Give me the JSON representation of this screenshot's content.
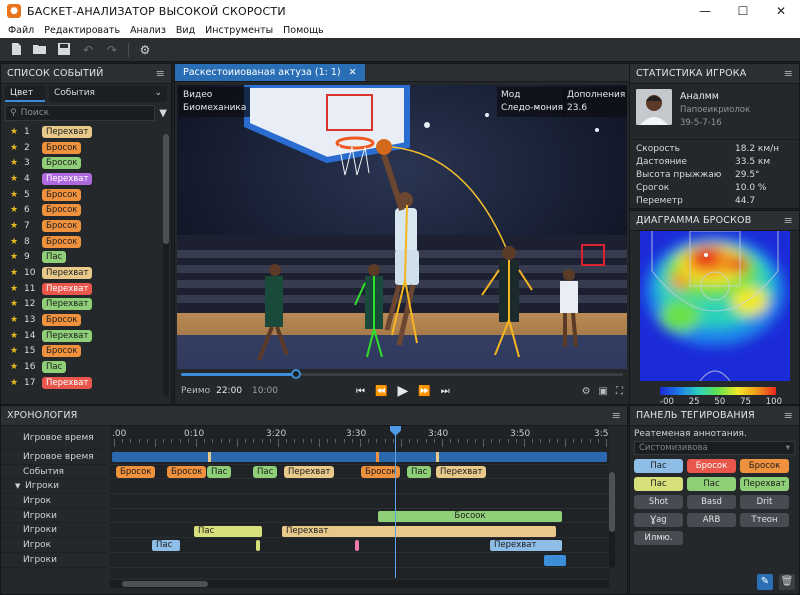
{
  "window": {
    "title": "БАСКЕТ-АНАЛИЗАТОР ВЫСОКОЙ СКОРОСТИ",
    "minimize": "—",
    "maximize": "☐",
    "close": "✕"
  },
  "menu": [
    "Файл",
    "Редактировать",
    "Анализ",
    "Вид",
    "Инструменты",
    "Помощь"
  ],
  "events_panel": {
    "title": "СПИСОК СОБЫТИЙ",
    "filter_color": "Цвет",
    "filter_events": "События",
    "search_placeholder": "Поиск",
    "items": [
      {
        "n": "1",
        "label": "Перехват",
        "color": "tan"
      },
      {
        "n": "2",
        "label": "Бросок",
        "color": "orange"
      },
      {
        "n": "3",
        "label": "Бросок",
        "color": "green"
      },
      {
        "n": "4",
        "label": "Перехват",
        "color": "purple"
      },
      {
        "n": "5",
        "label": "Бросок",
        "color": "orange"
      },
      {
        "n": "6",
        "label": "Бросок",
        "color": "orange"
      },
      {
        "n": "7",
        "label": "Бросок",
        "color": "orange"
      },
      {
        "n": "8",
        "label": "Бросок",
        "color": "orange"
      },
      {
        "n": "9",
        "label": "Пас",
        "color": "green"
      },
      {
        "n": "10",
        "label": "Перехват",
        "color": "tan"
      },
      {
        "n": "11",
        "label": "Перехват",
        "color": "red"
      },
      {
        "n": "12",
        "label": "Перехват",
        "color": "green"
      },
      {
        "n": "13",
        "label": "Бросок",
        "color": "orange"
      },
      {
        "n": "14",
        "label": "Перехват",
        "color": "green"
      },
      {
        "n": "15",
        "label": "Бросок",
        "color": "orange"
      },
      {
        "n": "16",
        "label": "Пас",
        "color": "green"
      },
      {
        "n": "17",
        "label": "Перехват",
        "color": "red"
      }
    ]
  },
  "video": {
    "tab": "Раскестоииованая актуза (1: 1)",
    "overlay_tl_1": "Видео",
    "overlay_tl_2": "Биомеханика",
    "overlay_mode_key": "Мод",
    "overlay_mode_val": "Следо-мония",
    "overlay_extra_key": "Дополнения",
    "overlay_extra_val": "23.6",
    "mode_label": "Реимо",
    "current_time": "22:00",
    "total_time": "10:00",
    "progress": 0.26
  },
  "player": {
    "title": "СТАТИСТИКА ИГРОКА",
    "name": "Аналмм",
    "position": "Папоеикриолок",
    "number": "39-5-7-16",
    "stats": [
      {
        "k": "Скорость",
        "v": "18.2 км/н"
      },
      {
        "k": "Дастояние",
        "v": "33.5 км"
      },
      {
        "k": "Высота прыжжаю",
        "v": "29.5°"
      },
      {
        "k": "Срогок",
        "v": "10.0 %"
      },
      {
        "k": "Переметр",
        "v": "44.7"
      }
    ]
  },
  "shot_chart": {
    "title": "ДИАГРАММА БРОСКОВ",
    "legend": [
      "-00",
      "25",
      "50",
      "75",
      "100"
    ]
  },
  "timeline": {
    "title": "ХРОНОЛОГИЯ",
    "ruler_labels": [
      ".00",
      "0:10",
      "3:20",
      "3:30",
      "3:40",
      "3:50",
      "3:5"
    ],
    "rows": [
      "Игровое время",
      "Игровое время",
      "События",
      "Игроки",
      "Игрок",
      "Игроки",
      "Игроки",
      "Игрок",
      "Игроки"
    ],
    "event_chips": [
      {
        "label": "Бросок",
        "color": "orange"
      },
      {
        "label": "Бросок",
        "color": "orange"
      },
      {
        "label": "Пас",
        "color": "green"
      },
      {
        "label": "Пас",
        "color": "green"
      },
      {
        "label": "Перехват",
        "color": "tan"
      },
      {
        "label": "Бросок",
        "color": "orange"
      },
      {
        "label": "Пас",
        "color": "green"
      },
      {
        "label": "Перехват",
        "color": "tan"
      }
    ],
    "bars": [
      {
        "row": 5,
        "label": "Босоок",
        "color": "green"
      },
      {
        "row": 6,
        "label": "Пас",
        "color": "yellowg"
      },
      {
        "row": 6,
        "label": "Перехват",
        "color": "tan"
      },
      {
        "row": 7,
        "label": "Пас",
        "color": "blue"
      },
      {
        "row": 7,
        "label": "Перехват",
        "color": "blue"
      }
    ]
  },
  "tagging": {
    "title": "ПАНЕЛЬ ТЕГИРОВАНИЯ",
    "subtitle": "Реатеменая аннотания.",
    "select_placeholder": "Систомизивова",
    "buttons": [
      {
        "label": "Пас",
        "color": "blue"
      },
      {
        "label": "Бросок",
        "color": "red"
      },
      {
        "label": "Бросок",
        "color": "orange"
      },
      {
        "label": "Пас",
        "color": "yellowg"
      },
      {
        "label": "Пас",
        "color": "green"
      },
      {
        "label": "Перехват",
        "color": "green"
      },
      {
        "label": "Shot",
        "color": "gray"
      },
      {
        "label": "Basd",
        "color": "gray"
      },
      {
        "label": "Drit",
        "color": "gray"
      },
      {
        "label": "Ɣag",
        "color": "gray"
      },
      {
        "label": "ARB",
        "color": "gray"
      },
      {
        "label": "Tтeон",
        "color": "gray"
      },
      {
        "label": "Илмю.",
        "color": "gray"
      }
    ]
  },
  "colors": {
    "accent": "#3d8ed8",
    "orange": "#f0913d",
    "green": "#8fcf77",
    "tan": "#e8c98a",
    "red": "#e8564c",
    "purple": "#b06ae0"
  }
}
